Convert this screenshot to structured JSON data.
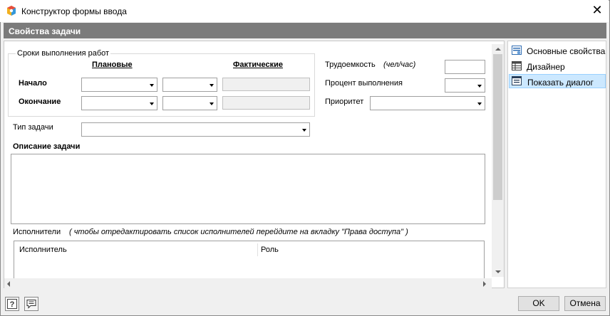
{
  "window": {
    "title": "Конструктор формы ввода",
    "close_glyph": "✕"
  },
  "section": {
    "title": "Свойства задачи"
  },
  "terms": {
    "group_title": "Сроки выполнения работ",
    "planned_header": "Плановые",
    "actual_header": "Фактические",
    "start_label": "Начало",
    "end_label": "Окончание"
  },
  "right_fields": {
    "labor_label": "Трудоемкость",
    "labor_unit": "(чел/час)",
    "percent_label": "Процент выполнения",
    "priority_label": "Приоритет"
  },
  "task_type_label": "Тип задачи",
  "description_label": "Описание задачи",
  "executors": {
    "label": "Исполнители",
    "hint": "( чтобы отредактировать список исполнителей перейдите на вкладку \"Права доступа\" )",
    "columns": [
      "Исполнитель",
      "Роль"
    ]
  },
  "side_menu": {
    "items": [
      {
        "label": "Основные свойства",
        "icon": "settings-form-icon"
      },
      {
        "label": "Дизайнер",
        "icon": "table-designer-icon"
      },
      {
        "label": "Показать диалог",
        "icon": "dialog-icon"
      }
    ],
    "selected": "Показать диалог"
  },
  "footer": {
    "ok_label": "OK",
    "cancel_label": "Отмена",
    "help_icon": "help-icon",
    "comment_icon": "comment-icon"
  }
}
